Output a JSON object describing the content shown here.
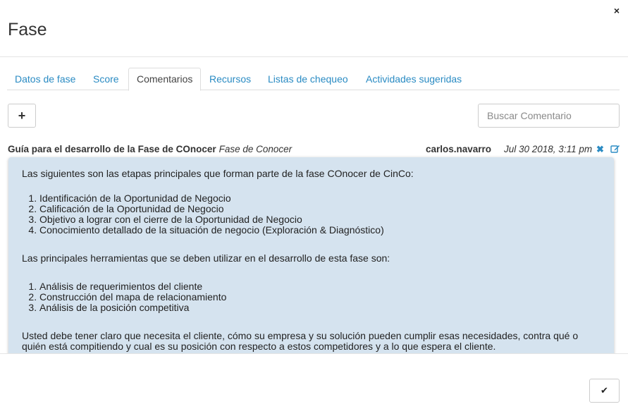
{
  "modal": {
    "title": "Fase",
    "close_icon": "×"
  },
  "tabs": [
    {
      "label": "Datos de fase",
      "active": false
    },
    {
      "label": "Score",
      "active": false
    },
    {
      "label": "Comentarios",
      "active": true
    },
    {
      "label": "Recursos",
      "active": false
    },
    {
      "label": "Listas de chequeo",
      "active": false
    },
    {
      "label": "Actividades sugeridas",
      "active": false
    }
  ],
  "toolbar": {
    "add_icon": "+",
    "search_placeholder": "Buscar Comentario"
  },
  "comment": {
    "title": "Guía para el desarrollo de la Fase de COnocer",
    "phase": "Fase de Conocer",
    "author": "carlos.navarro",
    "date": "Jul 30 2018, 3:11 pm",
    "delete_icon": "✖",
    "edit_icon": "edit-icon",
    "body": {
      "intro": "Las siguientes son las etapas principales que forman parte de la fase COnocer de CinCo:",
      "stages": [
        "Identificación de la Oportunidad de Negocio",
        "Calificación de la Oportunidad de Negocio",
        "Objetivo a lograr con el cierre de la Oportunidad de Negocio",
        "Conocimiento detallado de la situación de negocio (Exploración & Diagnóstico)"
      ],
      "tools_intro": "Las principales herramientas que se deben utilizar en el desarrollo de esta fase son:",
      "tools": [
        "Análisis de requerimientos del cliente",
        "Construcción del mapa de relacionamiento",
        "Análisis de la posición competitiva"
      ],
      "closing": "Usted debe tener claro que necesita el cliente, cómo su empresa y su solución pueden cumplir esas necesidades, contra qué o quién está compitiendo y cual es su posición con respecto a estos competidores y a lo que espera el cliente."
    }
  },
  "footer": {
    "confirm_icon": "✔"
  },
  "colors": {
    "link": "#2a8bc3",
    "comment_bg": "#d5e3ef"
  }
}
